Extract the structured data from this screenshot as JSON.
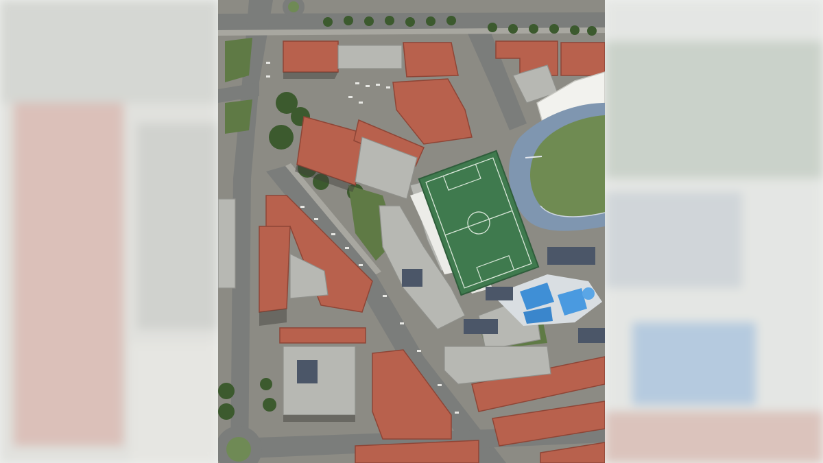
{
  "viewer": {
    "mode": "aerial-photo",
    "background_color": "#eef0ee"
  },
  "map": {
    "layer": "orthophoto",
    "features": [
      {
        "kind": "football-pitch",
        "color": "#3f7a4e"
      },
      {
        "kind": "running-track",
        "color": "#7f96b0"
      },
      {
        "kind": "swimming-pool",
        "color": "#3f8fd6"
      },
      {
        "kind": "roundabout",
        "color": "#7a8a6a"
      },
      {
        "kind": "red-tile-roofs",
        "color": "#b8614d"
      },
      {
        "kind": "street",
        "color": "#7c7e7c"
      }
    ]
  }
}
